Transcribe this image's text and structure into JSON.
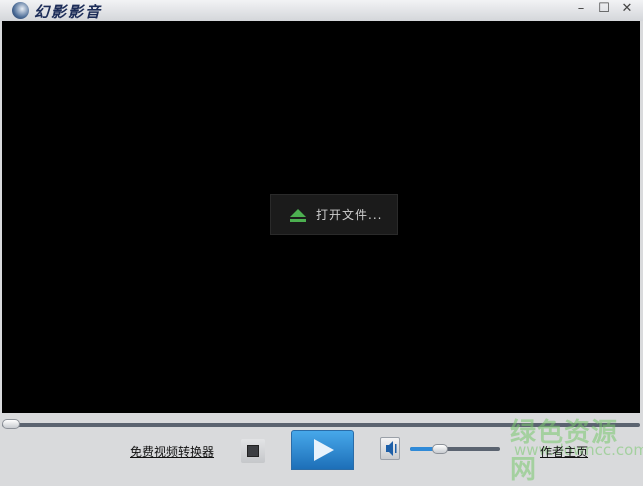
{
  "app": {
    "title": "幻影影音"
  },
  "window": {
    "minimize": "–",
    "maximize": "☐",
    "close": "✕"
  },
  "video": {
    "open_file_label": "打开文件...",
    "accent": "#4caf50"
  },
  "playback": {
    "position": 0,
    "volume": 0.3
  },
  "controls": {
    "converter_link": "免费视频转换器",
    "author_link": "作者主页"
  },
  "watermark": {
    "name": "绿色资源网",
    "url": "www.downcc.com"
  }
}
